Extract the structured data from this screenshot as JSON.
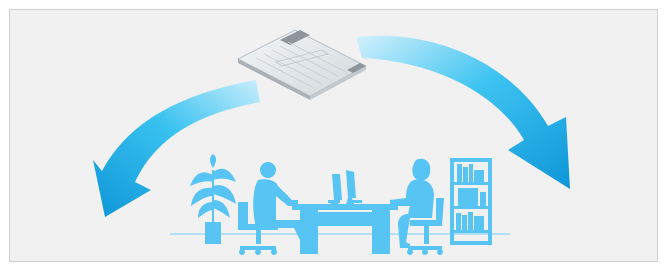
{
  "figure": {
    "background": "#f1f1f1",
    "border_color": "#cfcfcf",
    "arrow_color_light": "#bfe9fb",
    "arrow_color_mid": "#39c2f0",
    "arrow_color_dark": "#0f96d8",
    "silhouette_color": "#57c4f3",
    "device_color": "#e7ebee"
  },
  "elements": {
    "ceiling_unit": {
      "icon": "ceiling-air-conditioner-icon"
    },
    "left_airflow": {
      "icon": "airflow-arrow-left-icon"
    },
    "right_airflow": {
      "icon": "airflow-arrow-right-icon"
    },
    "office_scene": {
      "icon": "office-silhouette-icon"
    }
  }
}
